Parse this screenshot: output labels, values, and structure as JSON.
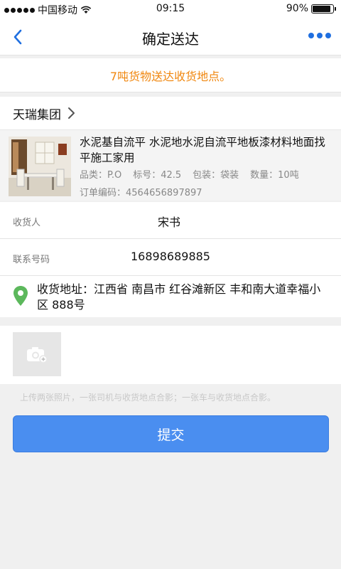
{
  "status_bar": {
    "carrier": "中国移动",
    "time": "09:15",
    "battery": "90%",
    "battery_level": 0.9
  },
  "nav": {
    "title": "确定送达",
    "back_icon": "chevron-left-icon",
    "more_icon": "more-dots-icon",
    "accent_color": "#1f6fe0"
  },
  "notice": {
    "text": "7吨货物送达收货地点。",
    "color": "#f0870f"
  },
  "company": {
    "name": "天瑞集团"
  },
  "product": {
    "title": "水泥基自流平 水泥地水泥自流平地板漆材料地面找平施工家用",
    "category": "品类：P.O",
    "grade": "标号：42.5",
    "packaging": "包装：袋装",
    "quantity": "数量：10吨",
    "order_no": "订单编码：4564656897897"
  },
  "receiver": {
    "label": "收货人",
    "value": "宋书"
  },
  "phone": {
    "label": "联系号码",
    "value": "16898689885"
  },
  "address": {
    "text": "收货地址：江西省 南昌市 红谷滩新区 丰和南大道幸福小区 888号",
    "pin_color": "#5cb85c"
  },
  "upload": {
    "icon": "camera-icon",
    "hint": "上传两张照片，一张司机与收货地点合影；一张车与收货地点合影。"
  },
  "submit": {
    "label": "提交",
    "color": "#4a8ef0"
  }
}
